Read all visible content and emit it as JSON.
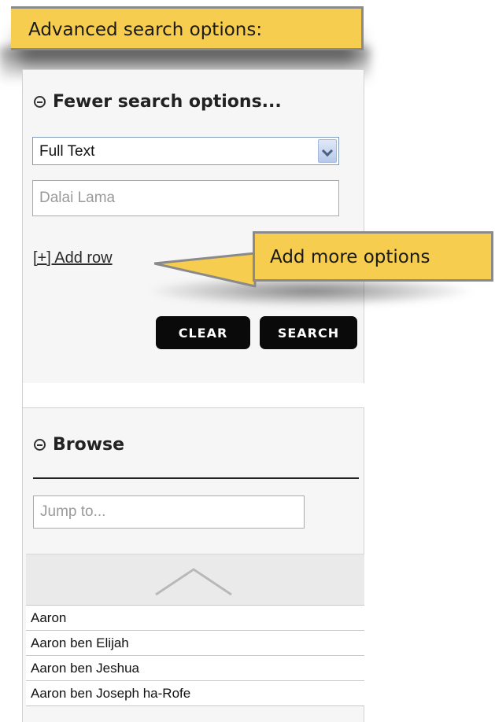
{
  "callouts": {
    "advanced": "Advanced search options:",
    "add_more": "Add more options"
  },
  "search_panel": {
    "title": "Fewer search options...",
    "field_select": {
      "selected": "Full Text"
    },
    "query_input": {
      "placeholder": "Dalai Lama"
    },
    "add_row_label": "[+] Add row",
    "clear_label": "CLEAR",
    "search_label": "SEARCH"
  },
  "browse_panel": {
    "title": "Browse",
    "jump_input": {
      "placeholder": "Jump to..."
    },
    "items": [
      {
        "label": "Aaron"
      },
      {
        "label": "Aaron ben Elijah"
      },
      {
        "label": "Aaron ben Jeshua"
      },
      {
        "label": "Aaron ben Joseph ha-Rofe"
      }
    ]
  },
  "colors": {
    "callout_fill": "#f6cd4e",
    "callout_border": "#8a8a8a",
    "button_bg": "#0a0a0a"
  },
  "icons": {
    "collapse": "minus-circle-icon",
    "dropdown": "chevron-down-icon",
    "scroll_up": "chevron-up-icon"
  }
}
